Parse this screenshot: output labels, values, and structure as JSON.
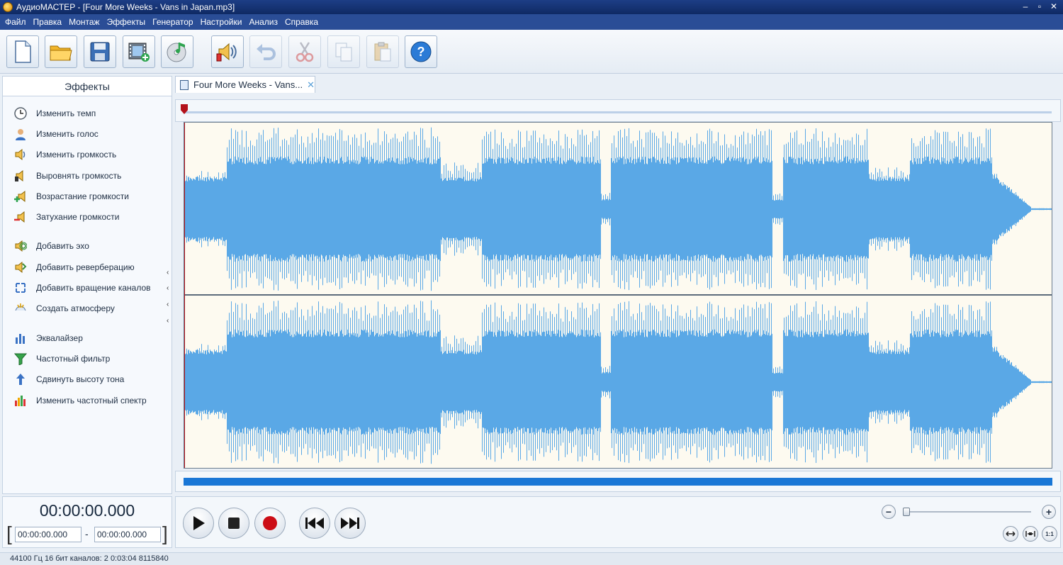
{
  "window": {
    "title": "АудиоМАСТЕР - [Four More Weeks - Vans in Japan.mp3]"
  },
  "menu": [
    "Файл",
    "Правка",
    "Монтаж",
    "Эффекты",
    "Генератор",
    "Настройки",
    "Анализ",
    "Справка"
  ],
  "toolbar": {
    "buttons": [
      {
        "icon": "new-file-icon",
        "enabled": true
      },
      {
        "icon": "open-folder-icon",
        "enabled": true
      },
      {
        "icon": "save-icon",
        "enabled": true
      },
      {
        "icon": "add-video-icon",
        "enabled": true
      },
      {
        "icon": "cd-music-icon",
        "enabled": true
      },
      {
        "icon": "speaker-volume-icon",
        "enabled": true
      },
      {
        "icon": "undo-icon",
        "enabled": false
      },
      {
        "icon": "cut-icon",
        "enabled": false
      },
      {
        "icon": "copy-icon",
        "enabled": false
      },
      {
        "icon": "paste-icon",
        "enabled": false
      },
      {
        "icon": "help-icon",
        "enabled": true
      }
    ]
  },
  "effects_panel": {
    "title": "Эффекты",
    "items": [
      {
        "label": "Изменить темп",
        "icon": "clock-icon"
      },
      {
        "label": "Изменить голос",
        "icon": "person-voice-icon"
      },
      {
        "label": "Изменить громкость",
        "icon": "volume-icon"
      },
      {
        "label": "Выровнять громкость",
        "icon": "volume-level-icon"
      },
      {
        "label": "Возрастание громкости",
        "icon": "fade-in-icon"
      },
      {
        "label": "Затухание громкости",
        "icon": "fade-out-icon"
      },
      {
        "label": "Добавить эхо",
        "icon": "echo-icon"
      },
      {
        "label": "Добавить реверберацию",
        "icon": "reverb-icon"
      },
      {
        "label": "Добавить вращение каналов",
        "icon": "channel-rotate-icon"
      },
      {
        "label": "Создать атмосферу",
        "icon": "atmosphere-icon"
      },
      {
        "label": "Эквалайзер",
        "icon": "equalizer-icon"
      },
      {
        "label": "Частотный фильтр",
        "icon": "filter-funnel-icon"
      },
      {
        "label": "Сдвинуть высоту тона",
        "icon": "pitch-shift-icon"
      },
      {
        "label": "Изменить частотный спектр",
        "icon": "spectrum-icon"
      }
    ]
  },
  "tab": {
    "label": "Four More Weeks - Vans...",
    "close": "✕"
  },
  "time": {
    "current": "00:00:00.000",
    "selection_start": "00:00:00.000",
    "selection_end": "00:00:00.000",
    "separator": "-"
  },
  "zoom": {
    "minus": "−",
    "plus": "+",
    "one_to_one": "1:1",
    "level": 0.0
  },
  "status": "44100 Гц   16 бит   каналов: 2    0:03:04 8115840",
  "colors": {
    "waveform": "#5aa8e6",
    "wave_background": "#fdfaf0",
    "scroll_thumb": "#1977d6",
    "playhead": "#b3121b"
  }
}
